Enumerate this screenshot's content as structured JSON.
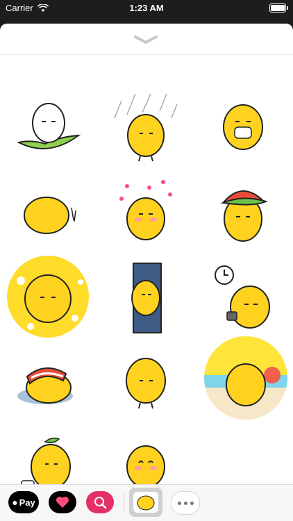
{
  "status_bar": {
    "carrier": "Carrier",
    "time": "1:23 AM"
  },
  "dock": {
    "apple_pay_label": "Pay",
    "more_label": "more"
  },
  "stickers": [
    {
      "name": "chick-on-leaf-sticker"
    },
    {
      "name": "chick-rain-sticker"
    },
    {
      "name": "chick-mask-sticker"
    },
    {
      "name": "chick-lying-sticker"
    },
    {
      "name": "chick-sparkles-sticker"
    },
    {
      "name": "chick-watermelon-hat-sticker"
    },
    {
      "name": "chick-cheese-sticker"
    },
    {
      "name": "chick-door-sticker"
    },
    {
      "name": "chick-clock-sticker"
    },
    {
      "name": "chick-sleeping-sticker"
    },
    {
      "name": "chick-standing-sticker"
    },
    {
      "name": "chick-beach-sticker"
    },
    {
      "name": "chick-luggage-sticker"
    },
    {
      "name": "chick-smile-sticker"
    }
  ]
}
